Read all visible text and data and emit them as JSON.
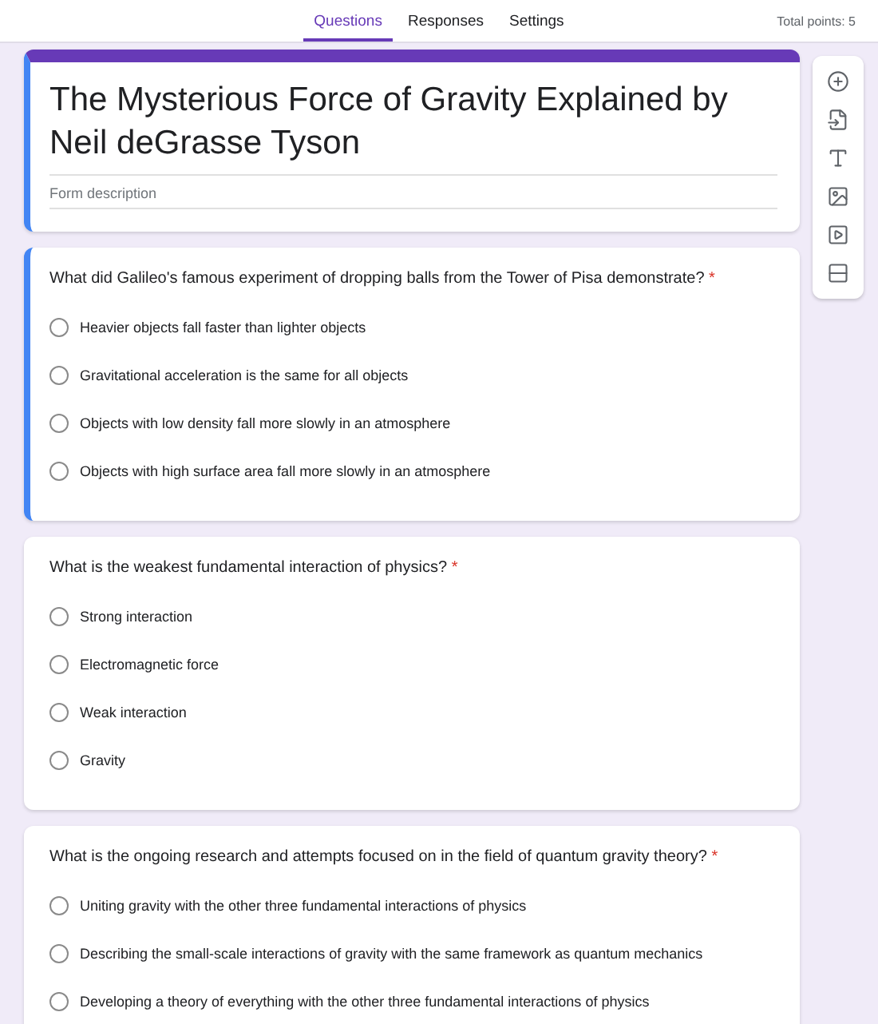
{
  "tabs": [
    {
      "label": "Questions",
      "selected": true
    },
    {
      "label": "Responses",
      "selected": false
    },
    {
      "label": "Settings",
      "selected": false
    }
  ],
  "total_points": "Total points: 5",
  "form": {
    "title": "The Mysterious Force of Gravity Explained by Neil deGrasse Tyson",
    "description_placeholder": "Form description",
    "focused": true
  },
  "questions": [
    {
      "text": "What did Galileo's famous experiment of dropping balls from the Tower of Pisa demonstrate?",
      "required_mark": "*",
      "focused": true,
      "options": [
        {
          "label": "Heavier objects fall faster than lighter objects",
          "selected": false
        },
        {
          "label": "Gravitational acceleration is the same for all objects",
          "selected": false
        },
        {
          "label": "Objects with low density fall more slowly in an atmosphere",
          "selected": false
        },
        {
          "label": "Objects with high surface area fall more slowly in an atmosphere",
          "selected": false
        }
      ]
    },
    {
      "text": "What is the weakest fundamental interaction of physics?",
      "required_mark": "*",
      "focused": false,
      "options": [
        {
          "label": "Strong interaction",
          "selected": false
        },
        {
          "label": "Electromagnetic force",
          "selected": false
        },
        {
          "label": "Weak interaction",
          "selected": false
        },
        {
          "label": "Gravity",
          "selected": false
        }
      ]
    },
    {
      "text": "What is the ongoing research and attempts focused on in the field of quantum gravity theory?",
      "required_mark": "*",
      "focused": false,
      "options": [
        {
          "label": "Uniting gravity with the other three fundamental interactions of physics",
          "selected": false
        },
        {
          "label": "Describing the small-scale interactions of gravity with the same framework as quantum mechanics",
          "selected": false
        },
        {
          "label": "Developing a theory of everything with the other three fundamental interactions of physics",
          "selected": false
        }
      ]
    }
  ],
  "toolbar": [
    {
      "kind": "add"
    },
    {
      "kind": "import"
    },
    {
      "kind": "title"
    },
    {
      "kind": "image"
    },
    {
      "kind": "video"
    },
    {
      "kind": "section"
    }
  ]
}
